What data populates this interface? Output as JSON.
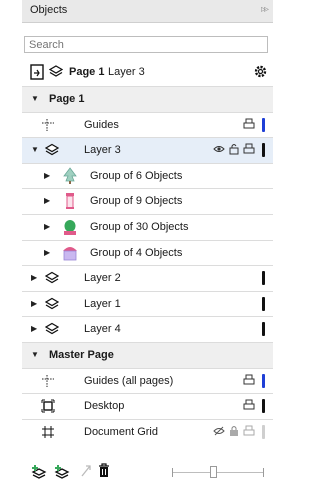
{
  "panel": {
    "title": "Objects",
    "expand_glyph": "▹▹",
    "search_placeholder": "Search"
  },
  "toolbar": {
    "page_label": "Page 1",
    "layer_label": "Layer 3",
    "icons": [
      "page-switch-icon",
      "layers-stack-icon",
      "gear-icon"
    ]
  },
  "colors": {
    "selection": "#e6eef8",
    "blue_bar": "#1f3fd6",
    "black_bar": "#111111",
    "header_bg": "#efefef",
    "accent_green": "#36a85a",
    "accent_pink": "#e05a8a"
  },
  "tree": {
    "page1": {
      "label": "Page 1"
    },
    "guides": {
      "label": "Guides"
    },
    "layer3": {
      "label": "Layer 3"
    },
    "groups": [
      {
        "label": "Group of 6 Objects"
      },
      {
        "label": "Group of 9 Objects"
      },
      {
        "label": "Group of 30 Objects"
      },
      {
        "label": "Group of 4 Objects"
      }
    ],
    "layer2": {
      "label": "Layer 2"
    },
    "layer1": {
      "label": "Layer 1"
    },
    "layer4": {
      "label": "Layer 4"
    },
    "master": {
      "label": "Master Page"
    },
    "guides_all": {
      "label": "Guides (all pages)"
    },
    "desktop": {
      "label": "Desktop"
    },
    "grid": {
      "label": "Document Grid"
    }
  }
}
